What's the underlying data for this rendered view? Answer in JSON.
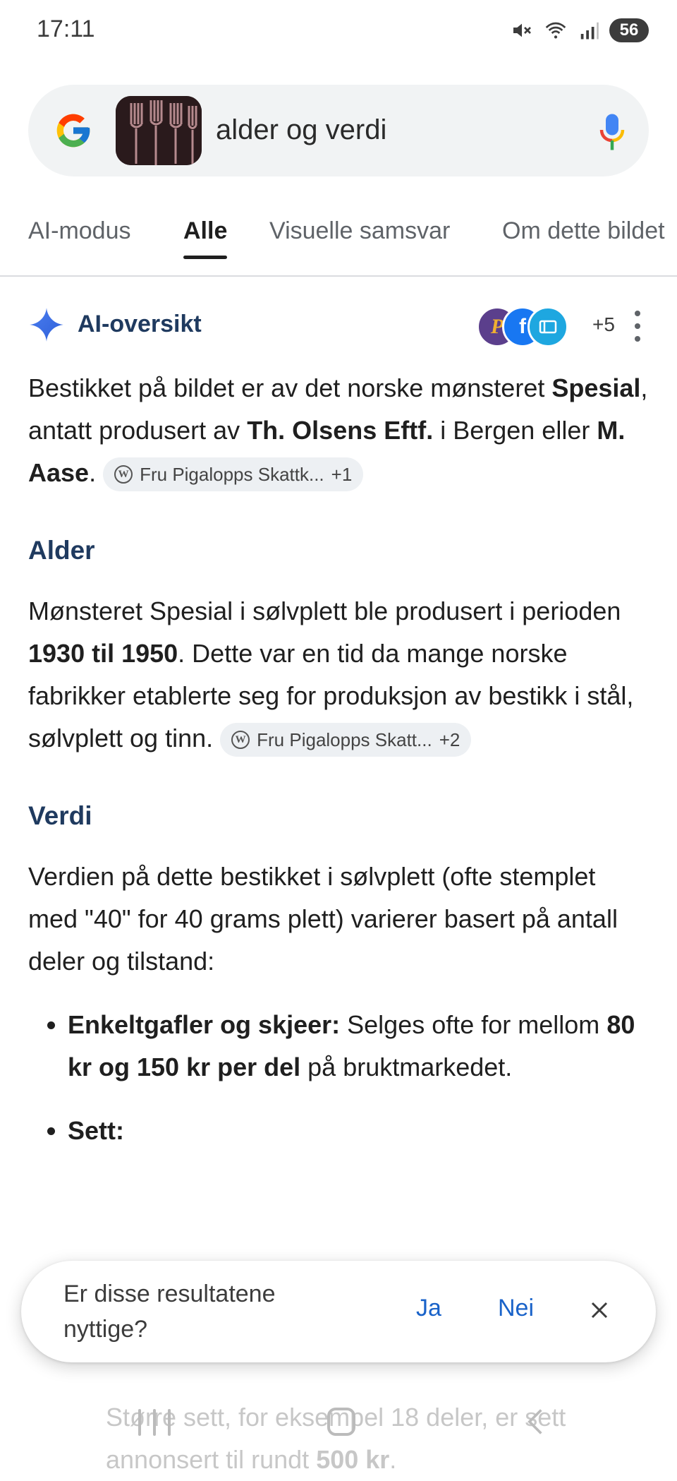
{
  "status_bar": {
    "time": "17:11",
    "battery": "56",
    "icons": [
      "mute-icon",
      "wifi-icon",
      "signal-icon",
      "battery-icon"
    ]
  },
  "search": {
    "query": "alder og verdi",
    "image_thumb": "forks-thumbnail"
  },
  "tabs": [
    {
      "label": "AI-modus"
    },
    {
      "label": "Alle"
    },
    {
      "label": "Visuelle samsvar"
    },
    {
      "label": "Om dette bildet"
    }
  ],
  "ai_overview": {
    "title": "AI-oversikt",
    "sources_more": "+5",
    "intro": {
      "t1": "Bestikket på bildet er av det norske mønsteret ",
      "b1": "Spesial",
      "t2": ", antatt produsert av ",
      "b2": "Th. Olsens Eftf.",
      "t3": " i Bergen eller ",
      "b3": "M. Aase",
      "t4": ".",
      "chip": {
        "label": "Fru Pigalopps Skattk...",
        "count": "+1"
      }
    },
    "alder": {
      "heading": "Alder",
      "t1": "Mønsteret Spesial i sølvplett ble produsert i perioden ",
      "b1": "1930 til 1950",
      "t2": ". Dette var en tid da mange norske fabrikker etablerte seg for produksjon av bestikk i stål, sølvplett og tinn.",
      "chip": {
        "label": "Fru Pigalopps Skatt...",
        "count": "+2"
      }
    },
    "verdi": {
      "heading": "Verdi",
      "intro": "Verdien på dette bestikket i sølvplett (ofte stemplet med \"40\" for 40 grams plett) varierer basert på antall deler og tilstand:",
      "bullet1": {
        "b1": "Enkeltgafler og skjeer:",
        "t1": " Selges ofte for mellom ",
        "b2": "80 kr og 150 kr per del",
        "t2": " på bruktmarkedet."
      },
      "bullet2": {
        "b1": "Sett:"
      },
      "faded_text": {
        "t1": "Større sett, for eksempel 18 deler, er sett annonsert til rundt ",
        "b1": "500 kr",
        "t2": "."
      }
    }
  },
  "feedback": {
    "question": "Er disse resultatene nyttige?",
    "yes": "Ja",
    "no": "Nei"
  },
  "colors": {
    "accent_blue": "#1a63c9",
    "heading_navy": "#1f3a5f"
  }
}
